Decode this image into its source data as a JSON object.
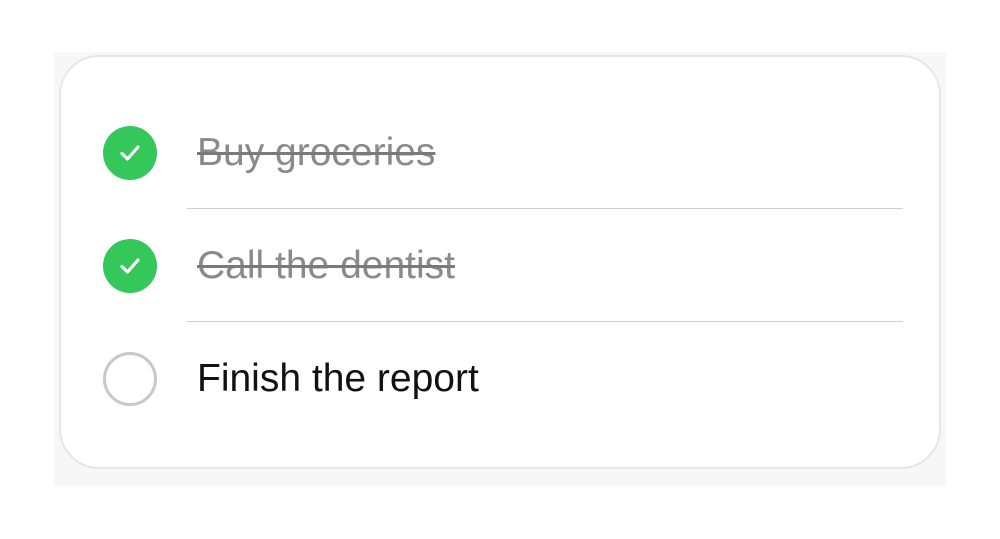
{
  "todo_list": {
    "items": [
      {
        "label": "Buy groceries",
        "completed": true
      },
      {
        "label": "Call the dentist",
        "completed": true
      },
      {
        "label": "Finish the report",
        "completed": false
      }
    ]
  },
  "colors": {
    "check_green": "#34c759",
    "completed_text": "#8a8a8a",
    "open_text": "#111111",
    "unchecked_ring": "#c8c8c8"
  },
  "icons": {
    "checked": "checkmark-circle-icon",
    "unchecked": "empty-circle-icon"
  }
}
